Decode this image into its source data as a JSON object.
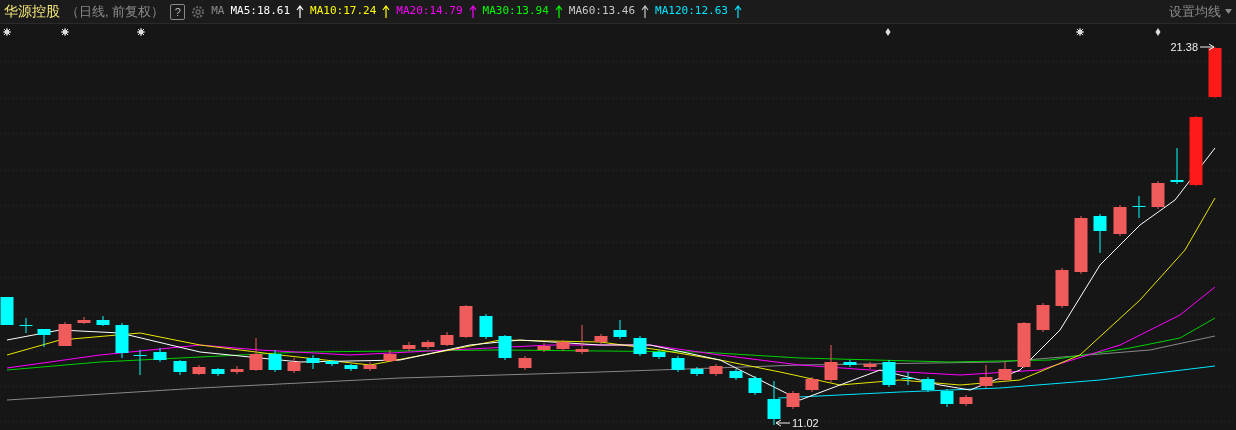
{
  "header": {
    "stock_name": "华源控股",
    "period": "（日线, 前复权）",
    "help": "?",
    "indicator": "MA",
    "averages": [
      {
        "label": "MA5:18.61",
        "color": "#ffffff"
      },
      {
        "label": "MA10:17.24",
        "color": "#ffff00"
      },
      {
        "label": "MA20:14.79",
        "color": "#ff00ff"
      },
      {
        "label": "MA30:13.94",
        "color": "#00ff00"
      },
      {
        "label": "MA60:13.46",
        "color": "#c8c8c8"
      },
      {
        "label": "MA120:12.63",
        "color": "#00e5ff"
      }
    ],
    "settings": "设置均线"
  },
  "chart": {
    "high_label": "21.38",
    "low_label": "11.02"
  }
}
